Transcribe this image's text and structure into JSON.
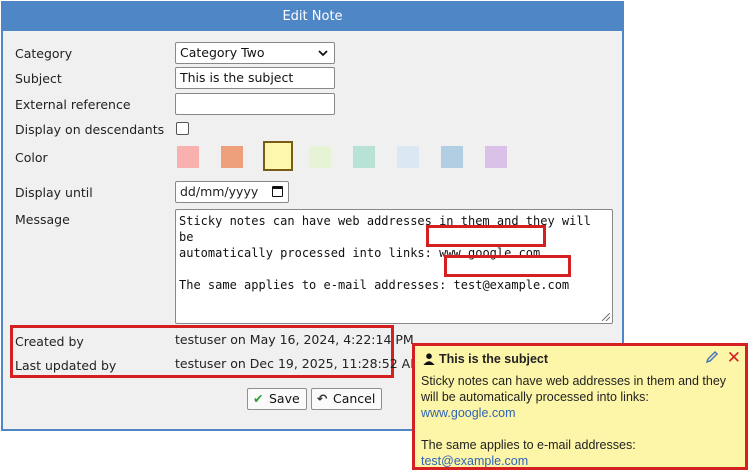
{
  "dialog": {
    "title": "Edit Note",
    "labels": {
      "category": "Category",
      "subject": "Subject",
      "external_reference": "External reference",
      "display_on_descendants": "Display on descendants",
      "color": "Color",
      "display_until": "Display until",
      "message": "Message",
      "created_by": "Created by",
      "last_updated_by": "Last updated by"
    },
    "category_value": "Category Two",
    "subject_value": "This is the subject",
    "external_reference_value": "",
    "display_on_descendants_checked": false,
    "display_until_placeholder": "dd/mm/yyyy",
    "colors": [
      "#f8b1ae",
      "#eea07b",
      "#fdf6ad",
      "#e6f4d5",
      "#b8e2d6",
      "#dbe8f4",
      "#b2cee2",
      "#d9c0e6"
    ],
    "selected_color_index": 2,
    "message": {
      "line1": "Sticky notes can have web addresses in them and they will be",
      "line2_prefix": "automatically processed into links: ",
      "link": "www.google.com",
      "line3_prefix": "The same applies to e-mail addresses: ",
      "email": "test@example.com"
    },
    "created_by_value": "testuser on May 16, 2024, 4:22:14 PM",
    "last_updated_by_value": "testuser on Dec 19, 2025, 11:28:52 AM",
    "buttons": {
      "save": "Save",
      "cancel": "Cancel"
    }
  },
  "note": {
    "title": "This is the subject",
    "body_line1": "Sticky notes can have web addresses in them and they",
    "body_line2": "will be automatically processed into links:",
    "link": "www.google.com",
    "body_line3": "The same applies to e-mail addresses:",
    "email": "test@example.com"
  },
  "icons": {
    "category_chevron": "chevron-down-icon",
    "date": "calendar-icon",
    "save": "check-icon",
    "cancel": "undo-icon",
    "note_user": "person-icon",
    "note_edit": "pencil-icon",
    "note_close": "close-icon"
  }
}
